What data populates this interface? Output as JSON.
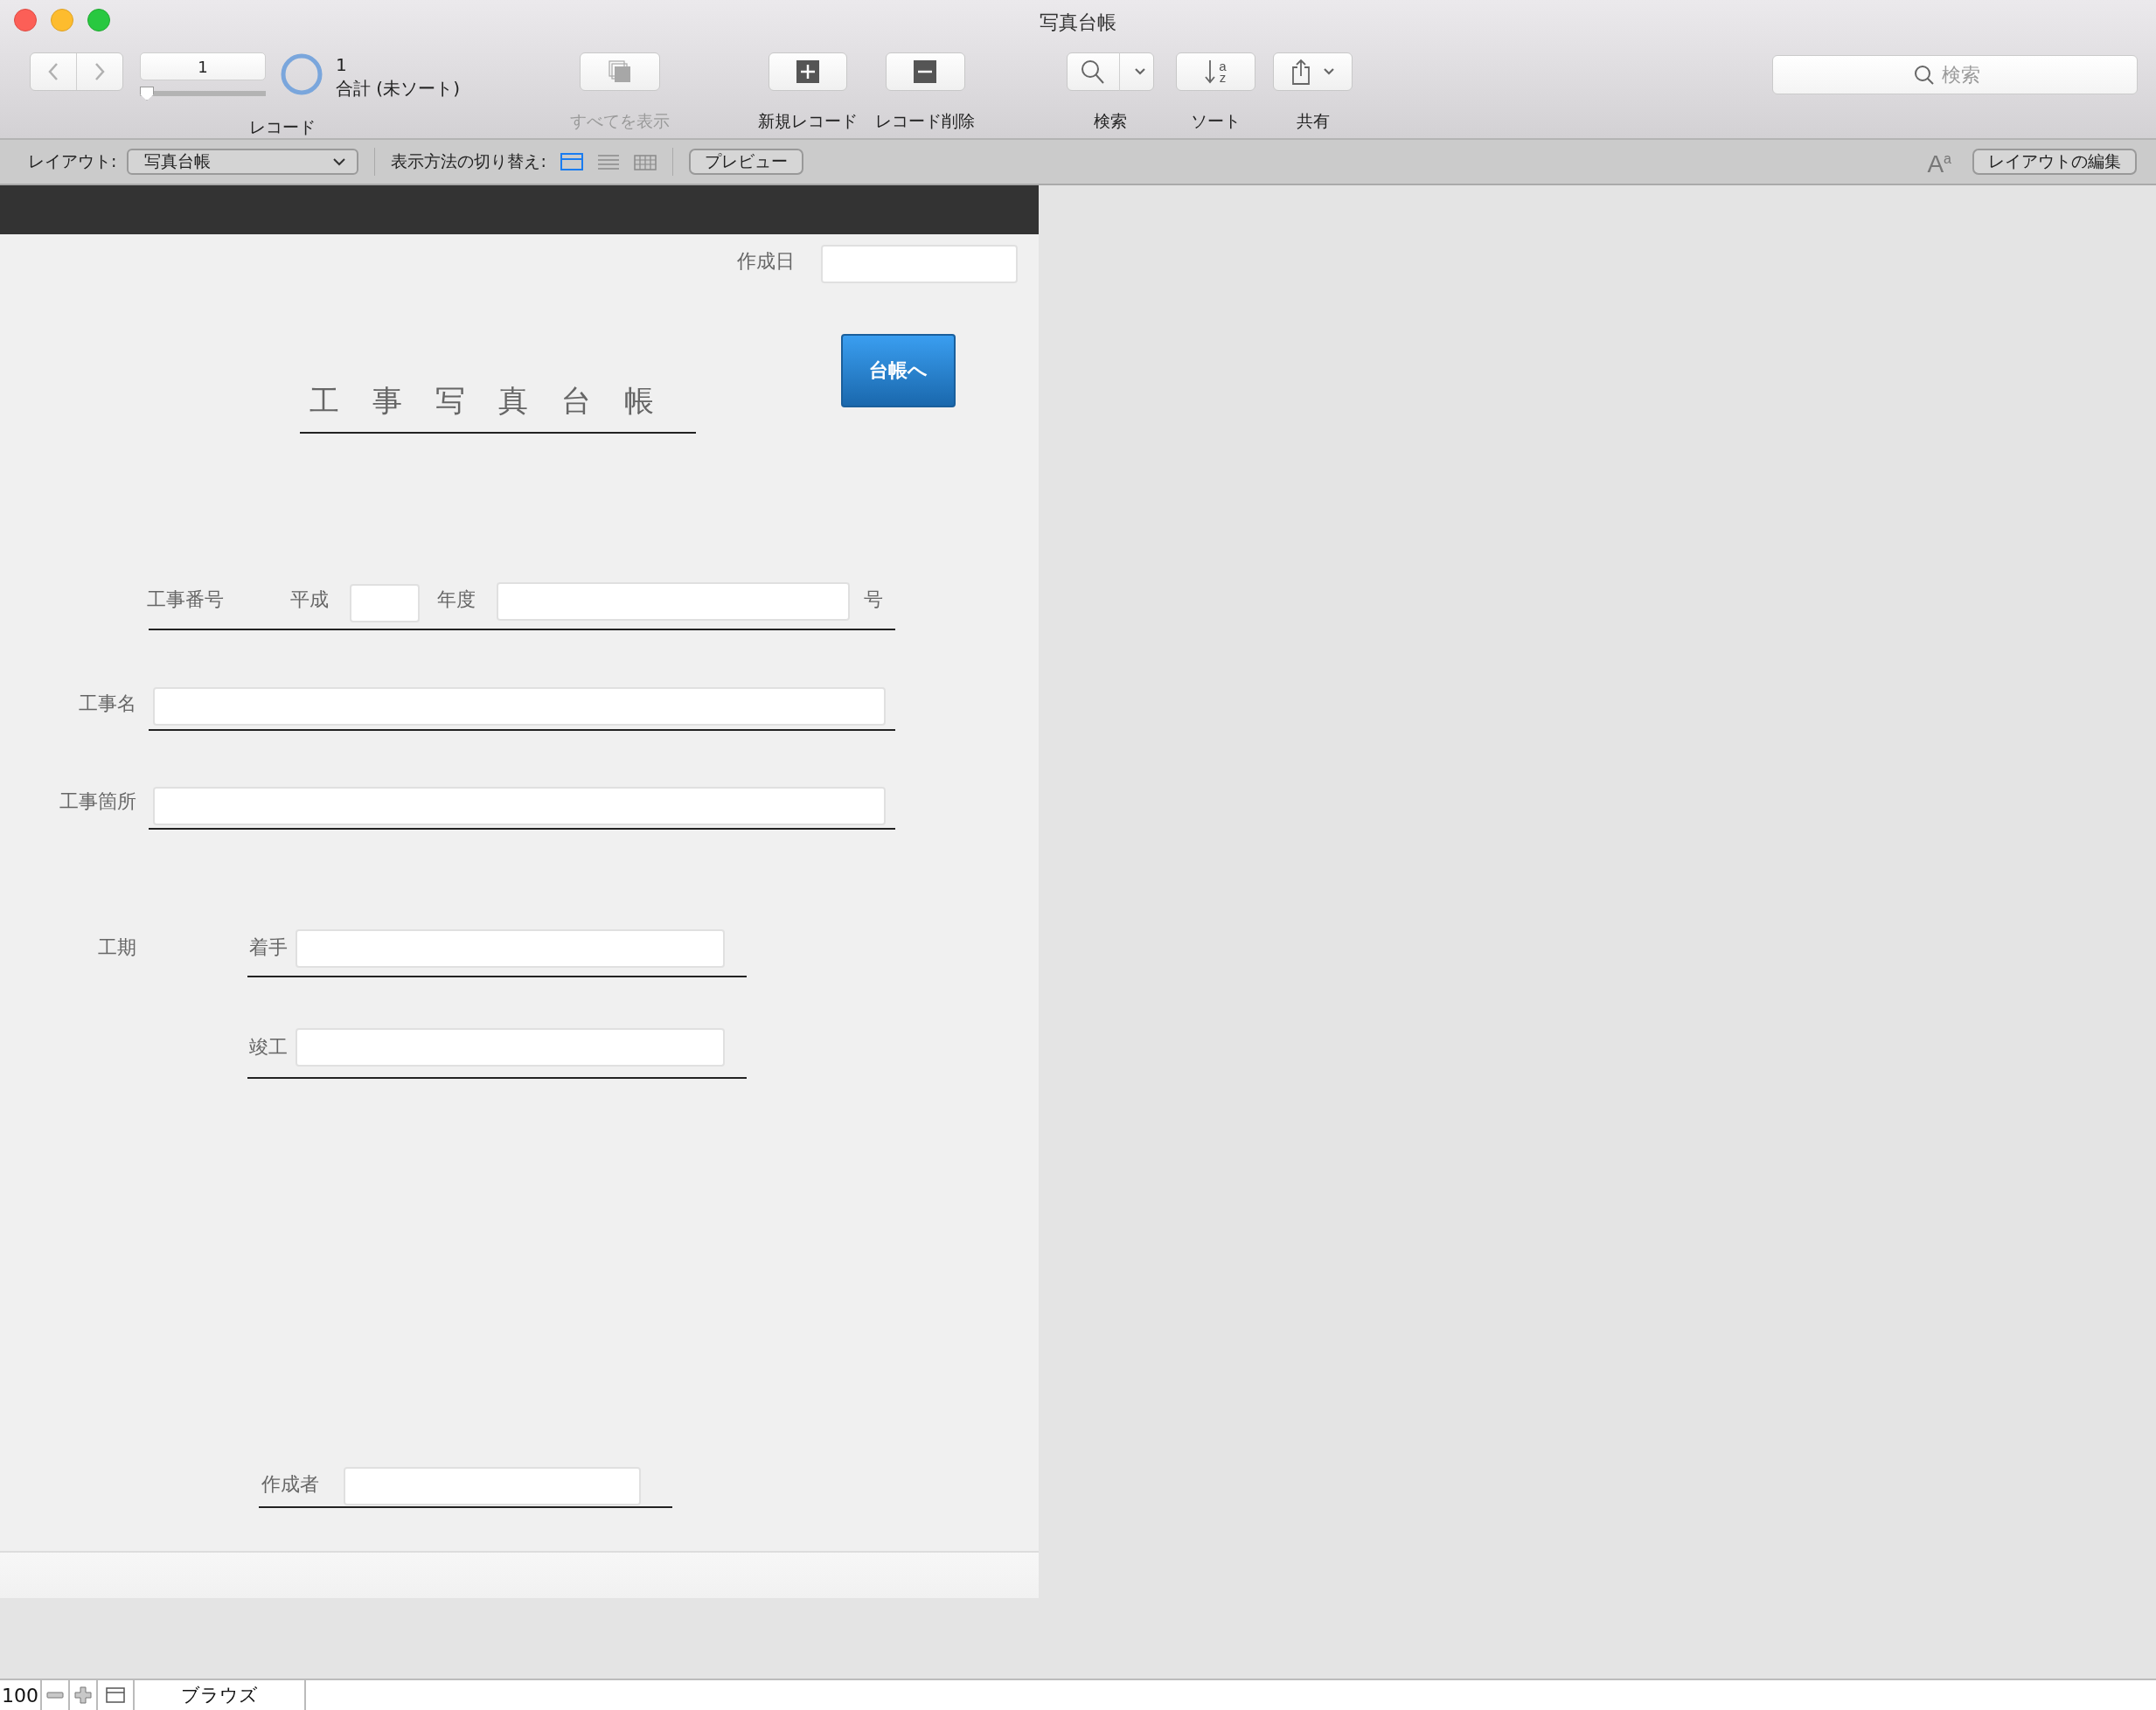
{
  "window": {
    "title": "写真台帳"
  },
  "toolbar": {
    "record_number": "1",
    "slider": {
      "level": 0
    },
    "record_count": "1",
    "record_total": "合計 (未ソート)",
    "record_label": "レコード",
    "buttons": [
      {
        "kind": "show-all",
        "label": "すべてを表示",
        "disabled": true
      },
      {
        "kind": "new",
        "label": "新規レコード",
        "disabled": false
      },
      {
        "kind": "delete",
        "label": "レコード削除",
        "disabled": false
      },
      {
        "kind": "find",
        "label": "検索",
        "disabled": false
      },
      {
        "kind": "sort",
        "label": "ソート",
        "disabled": false,
        "icon_letters": [
          "a",
          "z"
        ]
      },
      {
        "kind": "share",
        "label": "共有",
        "disabled": false
      }
    ],
    "search": {
      "placeholder": "検索"
    }
  },
  "layout_bar": {
    "layout_label": "レイアウト:",
    "layout_value": "写真台帳",
    "view_label": "表示方法の切り替え:",
    "views": [
      {
        "kind": "form",
        "selected": true
      },
      {
        "kind": "list",
        "selected": false
      },
      {
        "kind": "table",
        "selected": false
      }
    ],
    "preview_button": "プレビュー",
    "font_button": "A$^{a}$",
    "edit_button": "レイアウトの編集"
  },
  "form": {
    "date_label": "作成日",
    "nav_button": "台帳へ",
    "title": "工事写真台帳",
    "number_row": {
      "label": "工事番号",
      "era": "平成",
      "year_label": "年度",
      "suffix": "号"
    },
    "name_row": {
      "label": "工事名"
    },
    "place_row": {
      "label": "工事箇所"
    },
    "period": {
      "label": "工期",
      "start_label": "着手",
      "end_label": "竣工"
    },
    "author": {
      "label": "作成者"
    }
  },
  "status_bar": {
    "zoom": "100",
    "mode": "ブラウズ"
  }
}
